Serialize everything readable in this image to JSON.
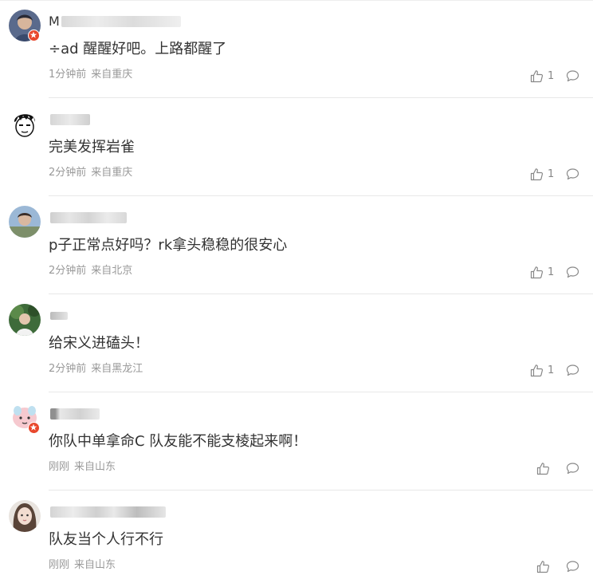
{
  "comments": [
    {
      "username_visible": "M",
      "text": "ad 醒醒好吧。上路都醒了",
      "text_prefix_glyph": "÷",
      "time": "1分钟前",
      "location": "来自重庆",
      "likes": "1",
      "verified": true,
      "like_icon": "thumbs-up-icon",
      "reply_icon": "comment-bubble-icon"
    },
    {
      "username_visible": "",
      "text": "完美发挥岩雀",
      "time": "2分钟前",
      "location": "来自重庆",
      "likes": "1",
      "verified": false
    },
    {
      "username_visible": "",
      "text": "p子正常点好吗？rk拿头稳稳的很安心",
      "time": "2分钟前",
      "location": "来自北京",
      "likes": "1",
      "verified": false
    },
    {
      "username_visible": "",
      "text": "给宋义进磕头！",
      "time": "2分钟前",
      "location": "来自黑龙江",
      "likes": "1",
      "verified": false
    },
    {
      "username_visible": "",
      "text": "你队中单拿命C 队友能不能支棱起来啊！",
      "time": "刚刚",
      "location": "来自山东",
      "likes": "",
      "verified": true
    },
    {
      "username_visible": "",
      "text": "队友当个人行不行",
      "time": "刚刚",
      "location": "来自山东",
      "likes": "",
      "verified": false
    }
  ],
  "colors": {
    "text": "#333333",
    "meta": "#999999",
    "divider": "#e8e8e8",
    "badge": "#e8472c"
  }
}
